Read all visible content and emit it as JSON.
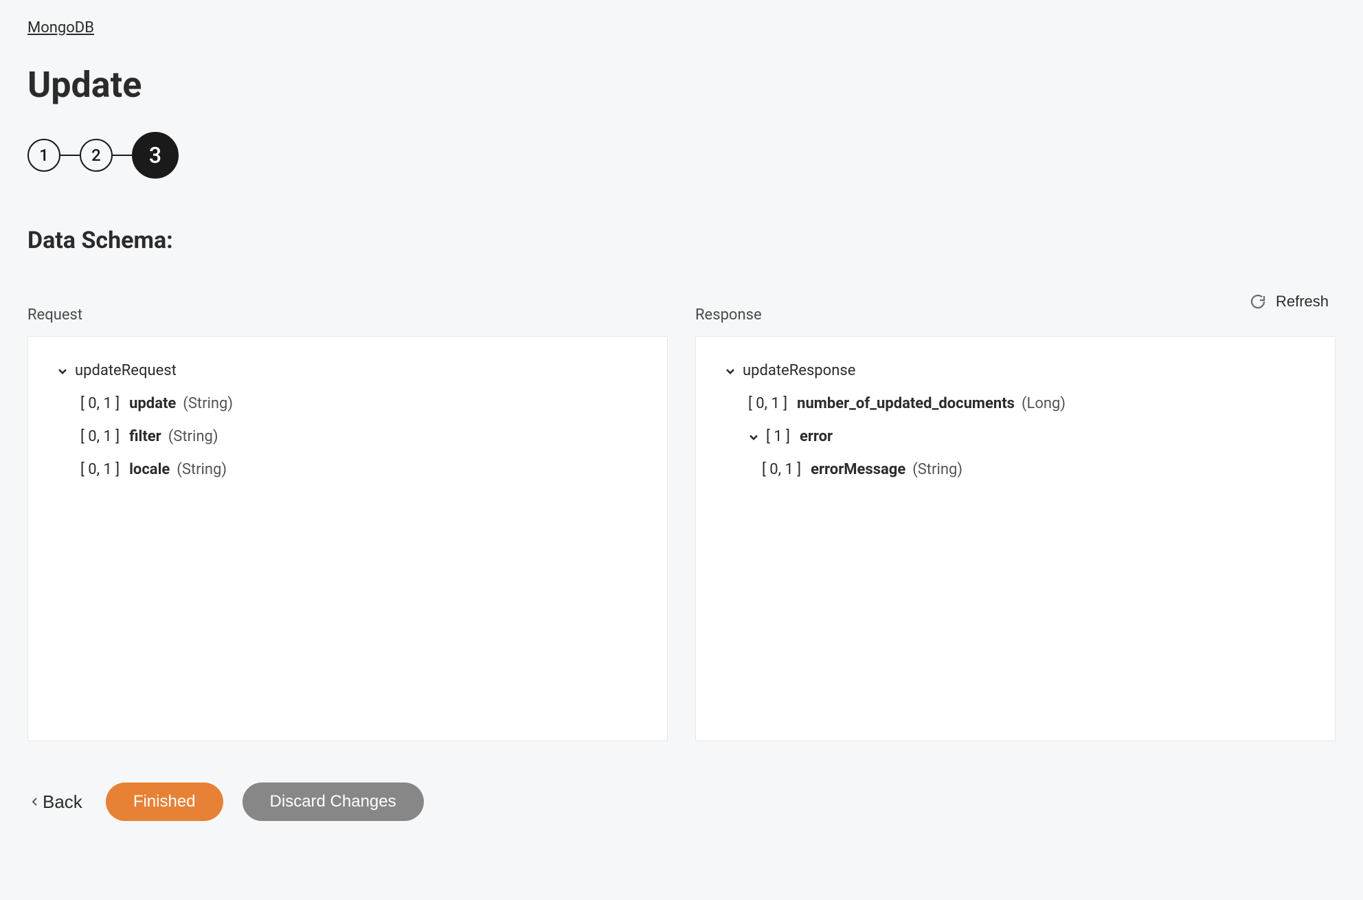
{
  "breadcrumb": "MongoDB",
  "title": "Update",
  "stepper": {
    "steps": [
      "1",
      "2",
      "3"
    ],
    "activeIndex": 2
  },
  "sectionTitle": "Data Schema:",
  "refresh": {
    "label": "Refresh"
  },
  "request": {
    "label": "Request",
    "root": "updateRequest",
    "fields": [
      {
        "cardinality": "[ 0, 1 ]",
        "name": "update",
        "type": "(String)"
      },
      {
        "cardinality": "[ 0, 1 ]",
        "name": "filter",
        "type": "(String)"
      },
      {
        "cardinality": "[ 0, 1 ]",
        "name": "locale",
        "type": "(String)"
      }
    ]
  },
  "response": {
    "label": "Response",
    "root": "updateResponse",
    "fields": [
      {
        "cardinality": "[ 0, 1 ]",
        "name": "number_of_updated_documents",
        "type": "(Long)"
      }
    ],
    "error": {
      "cardinality": "[ 1 ]",
      "name": "error",
      "fields": [
        {
          "cardinality": "[ 0, 1 ]",
          "name": "errorMessage",
          "type": "(String)"
        }
      ]
    }
  },
  "actions": {
    "back": "Back",
    "finished": "Finished",
    "discard": "Discard Changes"
  }
}
